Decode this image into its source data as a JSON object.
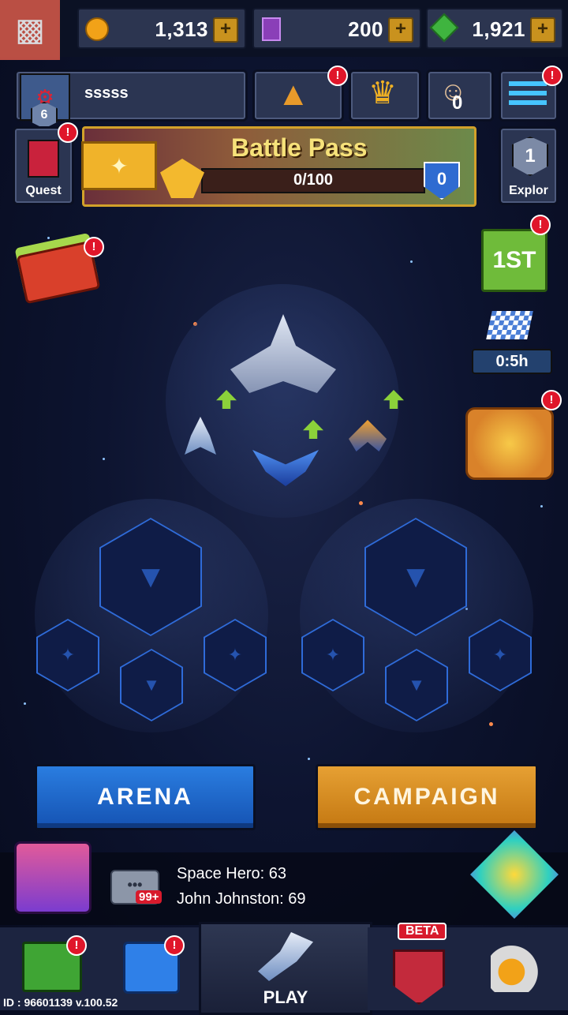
{
  "currency": {
    "coins": "1,313",
    "cards": "200",
    "gems": "1,921"
  },
  "profile": {
    "name": "sssss",
    "level": "6"
  },
  "header_buttons": {
    "quest_label": "Quest",
    "explore_label": "Explor",
    "explore_count": "1",
    "battle_pass_title": "Battle Pass",
    "battle_pass_progress": "0/100",
    "battle_pass_level": "0",
    "rank_badge_count": "0"
  },
  "side_events": {
    "timer": "0:5h"
  },
  "modes": {
    "arena_label": "ARENA",
    "campaign_label": "CAMPAIGN"
  },
  "chat": {
    "unread": "99+",
    "lines": [
      "Space Hero: 63",
      "John Johnston: 69"
    ]
  },
  "bottom_nav": {
    "play_label": "PLAY",
    "beta_label": "BETA"
  },
  "footer": {
    "build": "ID : 96601139 v.100.52"
  },
  "colors": {
    "accent_blue": "#1f63c9",
    "accent_orange": "#d98a1d",
    "alert_red": "#e0162a"
  }
}
